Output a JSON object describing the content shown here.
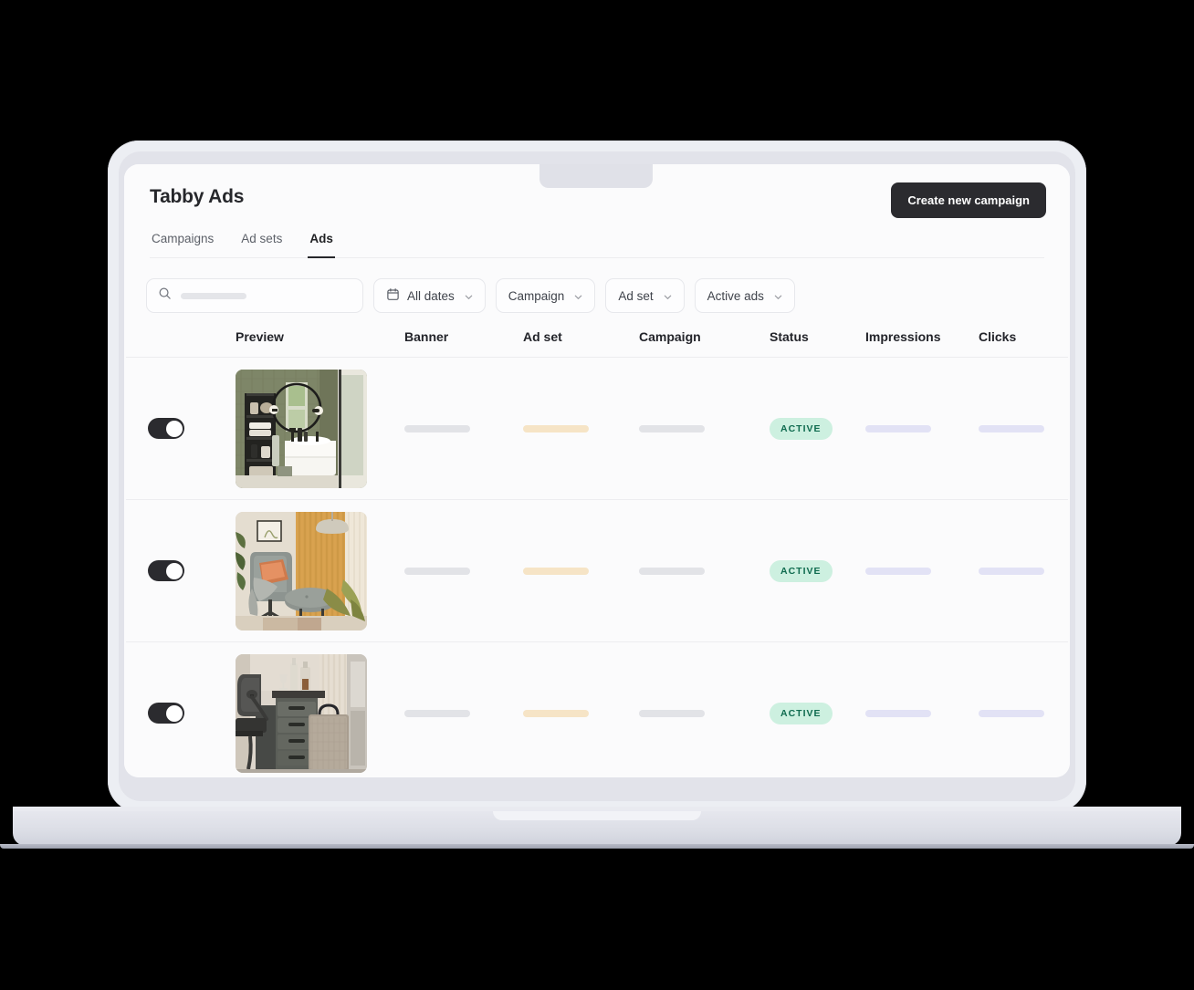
{
  "app": {
    "title": "Tabby Ads",
    "create_button": "Create new campaign",
    "tabs": [
      {
        "label": "Campaigns",
        "active": false
      },
      {
        "label": "Ad sets",
        "active": false
      },
      {
        "label": "Ads",
        "active": true
      }
    ]
  },
  "filters": {
    "search_placeholder": "",
    "search_icon": "search-icon",
    "date_filter": "All dates",
    "date_icon": "calendar-icon",
    "campaign_filter": "Campaign",
    "adset_filter": "Ad set",
    "status_filter": "Active ads",
    "chevron_icon": "chevron-down-icon"
  },
  "table": {
    "headers": {
      "toggle": "",
      "preview": "Preview",
      "banner": "Banner",
      "adset": "Ad set",
      "campaign": "Campaign",
      "status": "Status",
      "impressions": "Impressions",
      "clicks": "Clicks"
    },
    "rows": [
      {
        "enabled": true,
        "preview_alt": "bathroom-green-tile-vanity-round-mirror",
        "status": "ACTIVE"
      },
      {
        "enabled": true,
        "preview_alt": "living-room-grey-armchair-ottoman-gold-curtains",
        "status": "ACTIVE"
      },
      {
        "enabled": true,
        "preview_alt": "home-office-dark-drawer-unit-chair-bag",
        "status": "ACTIVE"
      }
    ]
  },
  "colors": {
    "accent_dark": "#2b2b2f",
    "badge_bg": "#cdf0e0",
    "badge_text": "#0f6b4f",
    "skeleton_gray": "#e2e3e7",
    "skeleton_tan": "#f6e4c6",
    "skeleton_lavender": "#e2e2f5",
    "surface": "#fbfbfc",
    "border": "#ececef"
  }
}
